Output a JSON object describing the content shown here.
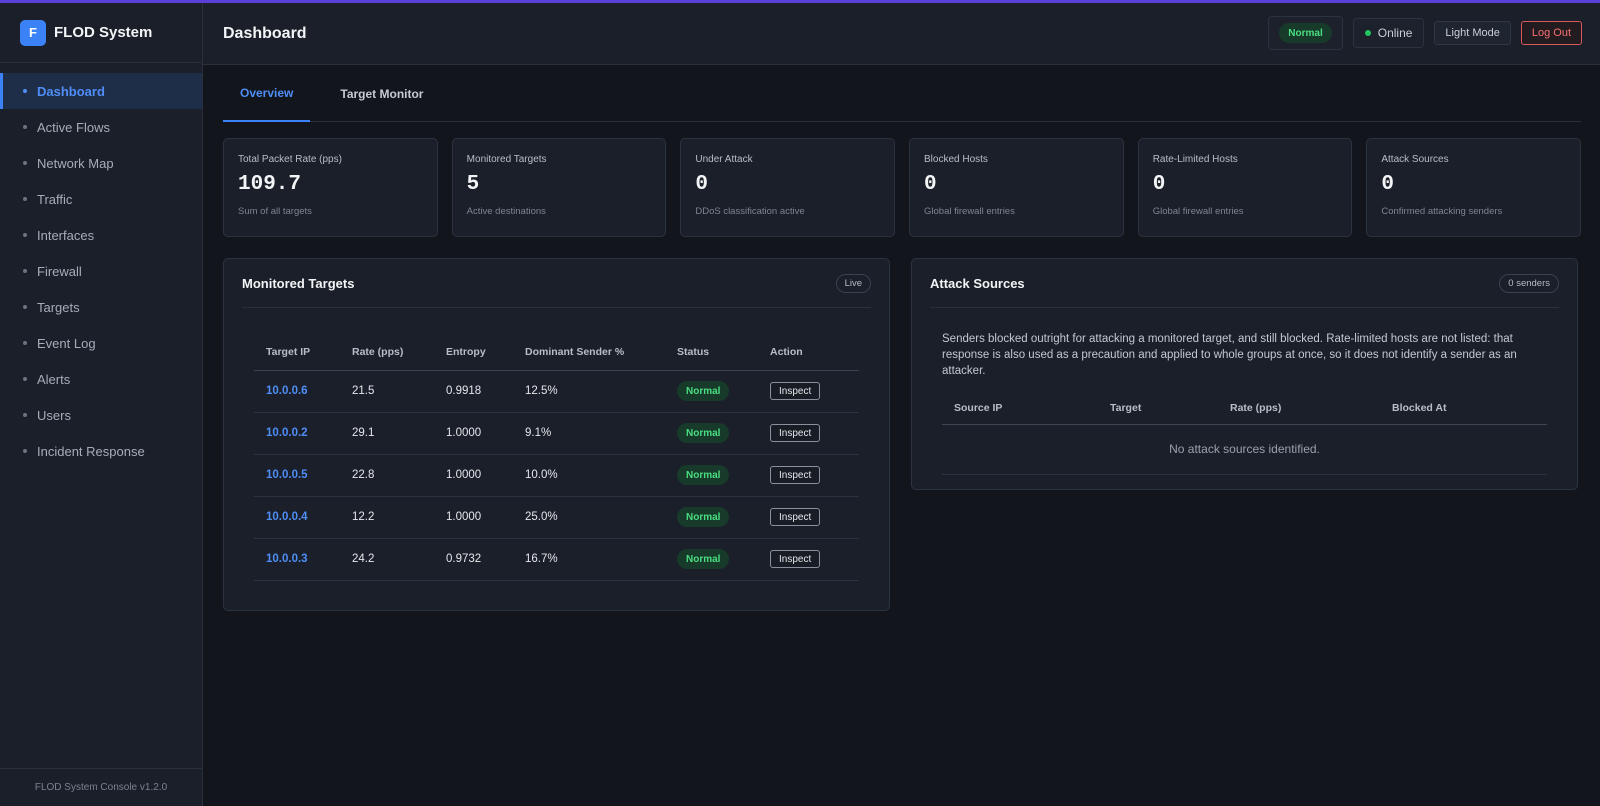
{
  "app": {
    "logo_letter": "F",
    "name": "FLOD System",
    "footer": "FLOD System Console v1.2.0"
  },
  "sidebar": {
    "items": [
      {
        "label": "Dashboard",
        "active": true
      },
      {
        "label": "Active Flows"
      },
      {
        "label": "Network Map"
      },
      {
        "label": "Traffic"
      },
      {
        "label": "Interfaces"
      },
      {
        "label": "Firewall"
      },
      {
        "label": "Targets"
      },
      {
        "label": "Event Log"
      },
      {
        "label": "Alerts"
      },
      {
        "label": "Users"
      },
      {
        "label": "Incident Response"
      }
    ]
  },
  "header": {
    "title": "Dashboard",
    "status": "Normal",
    "online": "Online",
    "light_mode": "Light Mode",
    "logout": "Log Out"
  },
  "tabs": [
    {
      "label": "Overview",
      "active": true
    },
    {
      "label": "Target Monitor"
    }
  ],
  "cards": [
    {
      "label": "Total Packet Rate (pps)",
      "value": "109.7",
      "sub": "Sum of all targets"
    },
    {
      "label": "Monitored Targets",
      "value": "5",
      "sub": "Active destinations"
    },
    {
      "label": "Under Attack",
      "value": "0",
      "sub": "DDoS classification active"
    },
    {
      "label": "Blocked Hosts",
      "value": "0",
      "sub": "Global firewall entries"
    },
    {
      "label": "Rate-Limited Hosts",
      "value": "0",
      "sub": "Global firewall entries"
    },
    {
      "label": "Attack Sources",
      "value": "0",
      "sub": "Confirmed attacking senders"
    }
  ],
  "monitored": {
    "title": "Monitored Targets",
    "badge": "Live",
    "columns": [
      "Target IP",
      "Rate (pps)",
      "Entropy",
      "Dominant Sender %",
      "Status",
      "Action"
    ],
    "rows": [
      {
        "ip": "10.0.0.6",
        "rate": "21.5",
        "entropy": "0.9918",
        "dominant": "12.5%",
        "status": "Normal",
        "action": "Inspect"
      },
      {
        "ip": "10.0.0.2",
        "rate": "29.1",
        "entropy": "1.0000",
        "dominant": "9.1%",
        "status": "Normal",
        "action": "Inspect"
      },
      {
        "ip": "10.0.0.5",
        "rate": "22.8",
        "entropy": "1.0000",
        "dominant": "10.0%",
        "status": "Normal",
        "action": "Inspect"
      },
      {
        "ip": "10.0.0.4",
        "rate": "12.2",
        "entropy": "1.0000",
        "dominant": "25.0%",
        "status": "Normal",
        "action": "Inspect"
      },
      {
        "ip": "10.0.0.3",
        "rate": "24.2",
        "entropy": "0.9732",
        "dominant": "16.7%",
        "status": "Normal",
        "action": "Inspect"
      }
    ]
  },
  "attack_sources": {
    "title": "Attack Sources",
    "badge": "0 senders",
    "description": "Senders blocked outright for attacking a monitored target, and still blocked. Rate-limited hosts are not listed: that response is also used as a precaution and applied to whole groups at once, so it does not identify a sender as an attacker.",
    "columns": [
      "Source IP",
      "Target",
      "Rate (pps)",
      "Blocked At"
    ],
    "empty": "No attack sources identified."
  },
  "colors": {
    "accent": "#3b82f6",
    "status_ok": "#4ade80",
    "danger": "#f87171",
    "background": "#12151c"
  }
}
